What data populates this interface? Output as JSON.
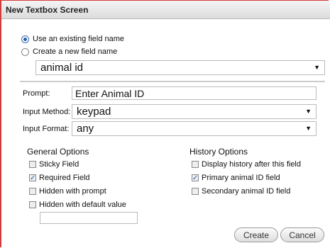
{
  "title": "New Textbox Screen",
  "field_choice": {
    "use_existing": {
      "label": "Use an existing field name",
      "selected": true
    },
    "create_new": {
      "label": "Create a new field name",
      "selected": false
    },
    "field_select": {
      "value": "animal id"
    }
  },
  "prompt": {
    "label": "Prompt:",
    "value": "Enter Animal ID"
  },
  "input_method": {
    "label": "Input Method:",
    "value": "keypad"
  },
  "input_format": {
    "label": "Input Format:",
    "value": "any"
  },
  "general_options": {
    "title": "General Options",
    "items": [
      {
        "label": "Sticky Field",
        "checked": false
      },
      {
        "label": "Required Field",
        "checked": true
      },
      {
        "label": "Hidden with prompt",
        "checked": false
      },
      {
        "label": "Hidden with default value",
        "checked": false
      }
    ],
    "default_value": ""
  },
  "history_options": {
    "title": "History Options",
    "items": [
      {
        "label": "Display history after this field",
        "checked": false
      },
      {
        "label": "Primary animal ID field",
        "checked": true
      },
      {
        "label": "Secondary animal ID field",
        "checked": false
      }
    ]
  },
  "buttons": {
    "create": "Create",
    "cancel": "Cancel"
  },
  "icons": {
    "dropdown": "chevron-down-icon",
    "check": "checkmark-icon"
  },
  "colors": {
    "border_accent": "#d43c3c",
    "radio_selected": "#1f5fb0",
    "check": "#2b56c2"
  }
}
